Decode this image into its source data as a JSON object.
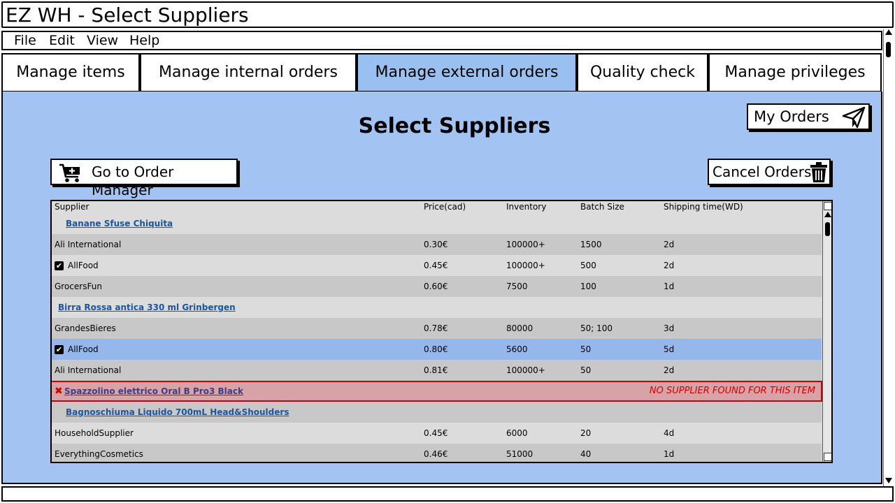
{
  "window": {
    "title": "EZ WH - Select Suppliers"
  },
  "menu": {
    "items": [
      "File",
      "Edit",
      "View",
      "Help"
    ]
  },
  "tabs": [
    {
      "label": "Manage items",
      "active": false
    },
    {
      "label": "Manage internal orders",
      "active": false
    },
    {
      "label": "Manage external orders",
      "active": true
    },
    {
      "label": "Quality check",
      "active": false
    },
    {
      "label": "Manage privileges",
      "active": false
    }
  ],
  "page": {
    "heading": "Select Suppliers",
    "my_orders_label": "My Orders",
    "go_to_order_manager_label": "Go to Order Manager",
    "cancel_orders_label": "Cancel Orders"
  },
  "table": {
    "columns": [
      "Supplier",
      "Price(cad)",
      "Inventory",
      "Batch Size",
      "Shipping time(WD)"
    ],
    "rows": [
      {
        "kind": "item",
        "name": "Banane Sfuse Chiquita"
      },
      {
        "kind": "supplier",
        "supplier": "Ali International",
        "price": "0.30€",
        "inventory": "100000+",
        "batch": "1500",
        "shipping": "2d",
        "checked": false
      },
      {
        "kind": "supplier",
        "supplier": "AllFood",
        "price": "0.45€",
        "inventory": "100000+",
        "batch": "500",
        "shipping": "2d",
        "checked": true
      },
      {
        "kind": "supplier",
        "supplier": "GrocersFun",
        "price": "0.60€",
        "inventory": "7500",
        "batch": "100",
        "shipping": "1d",
        "checked": false
      },
      {
        "kind": "item",
        "name": "Birra Rossa antica 330 ml Grinbergen"
      },
      {
        "kind": "supplier",
        "supplier": "GrandesBieres",
        "price": "0.78€",
        "inventory": "80000",
        "batch": "50; 100",
        "shipping": "3d",
        "checked": false
      },
      {
        "kind": "supplier",
        "supplier": "AllFood",
        "price": "0.80€",
        "inventory": "5600",
        "batch": "50",
        "shipping": "5d",
        "checked": true,
        "selected": true
      },
      {
        "kind": "supplier",
        "supplier": "Ali International",
        "price": "0.81€",
        "inventory": "100000+",
        "batch": "50",
        "shipping": "2d",
        "checked": false
      },
      {
        "kind": "error",
        "name": "Spazzolino elettrico Oral B Pro3 Black",
        "message": "NO SUPPLIER FOUND FOR THIS ITEM"
      },
      {
        "kind": "item",
        "name": "Bagnoschiuma Liquido 700mL Head&Shoulders"
      },
      {
        "kind": "supplier",
        "supplier": "HouseholdSupplier",
        "price": "0.45€",
        "inventory": "6000",
        "batch": "20",
        "shipping": "4d",
        "checked": false
      },
      {
        "kind": "supplier",
        "supplier": "EverythingCosmetics",
        "price": "0.46€",
        "inventory": "51000",
        "batch": "40",
        "shipping": "1d",
        "checked": false
      }
    ]
  },
  "icons": {
    "my_orders": "paper-plane-icon",
    "go_to_order_manager": "cart-add-icon",
    "cancel_orders": "trash-icon",
    "checked": "checkbox-checked-icon",
    "error": "x-mark-icon"
  },
  "colors": {
    "panel": "#a3c4f3",
    "active_tab": "#99c0f0",
    "selected_row": "#95b7ec",
    "error_row": "#d8a3a6",
    "error_text": "#d40000",
    "link": "#1a55a3"
  }
}
